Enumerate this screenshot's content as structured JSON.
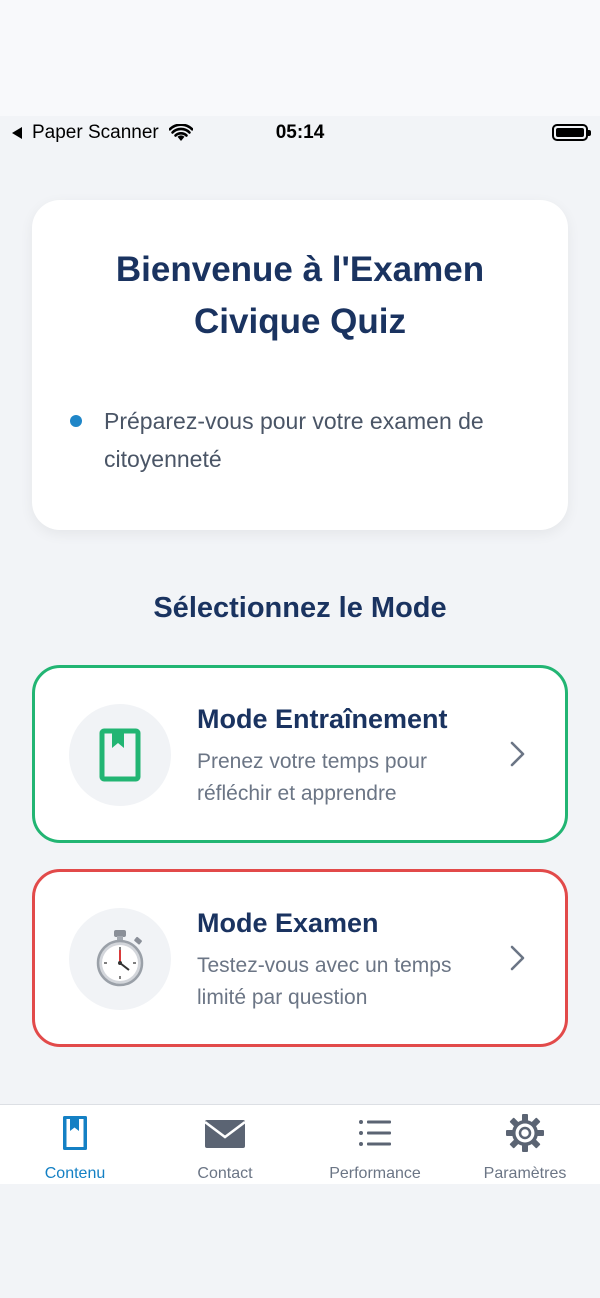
{
  "status_bar": {
    "carrier": "Paper Scanner",
    "time": "05:14"
  },
  "welcome": {
    "title_line1": "Bienvenue à l'Examen",
    "title_line2": "Civique Quiz",
    "bullet": "Préparez-vous pour votre examen de citoyenneté"
  },
  "section_title": "Sélectionnez le Mode",
  "modes": [
    {
      "title": "Mode Entraînement",
      "description": "Prenez votre temps pour réfléchir et apprendre",
      "icon": "bookmark-book-icon",
      "border_color": "#22b573"
    },
    {
      "title": "Mode Examen",
      "description": "Testez-vous avec un temps limité par question",
      "icon": "stopwatch-icon",
      "border_color": "#e24a4a"
    }
  ],
  "tabs": [
    {
      "label": "Contenu",
      "icon": "book-icon",
      "active": true
    },
    {
      "label": "Contact",
      "icon": "envelope-icon",
      "active": false
    },
    {
      "label": "Performance",
      "icon": "list-icon",
      "active": false
    },
    {
      "label": "Paramètres",
      "icon": "gear-icon",
      "active": false
    }
  ],
  "colors": {
    "title_navy": "#1a3360",
    "accent_blue": "#1480c4",
    "training_green": "#22b573",
    "exam_red": "#e24a4a"
  }
}
